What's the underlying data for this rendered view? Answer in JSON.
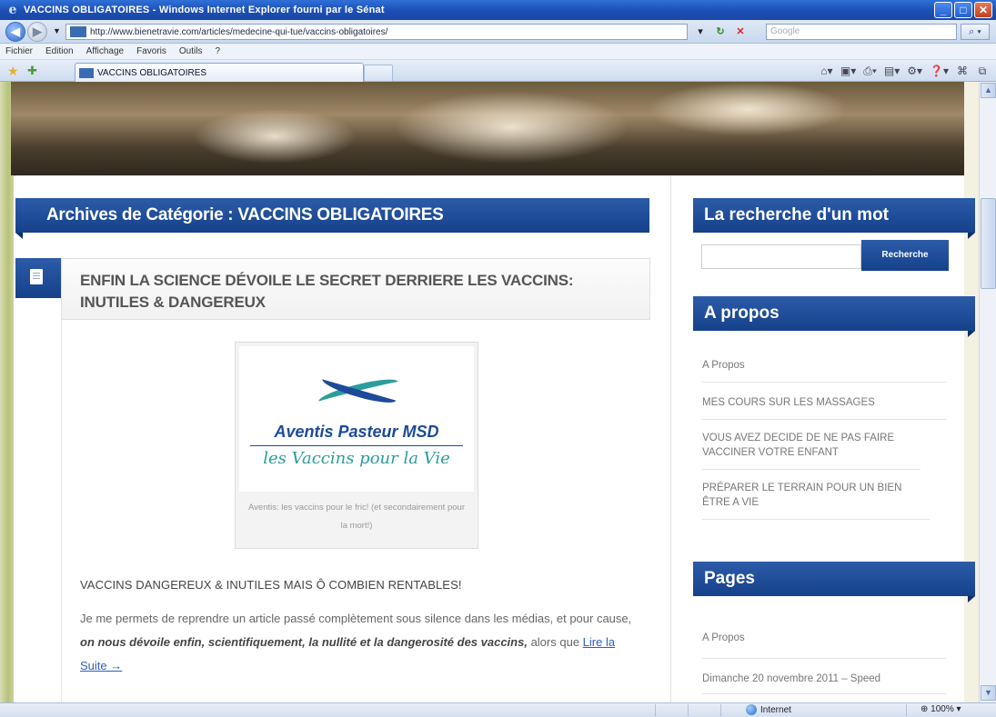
{
  "window": {
    "title": "VACCINS OBLIGATOIRES - Windows Internet Explorer fourni par le Sénat"
  },
  "address": {
    "url": "http://www.bienetravie.com/articles/medecine-qui-tue/vaccins-obligatoires/",
    "search_placeholder": "Google"
  },
  "menu": [
    "Fichier",
    "Edition",
    "Affichage",
    "Favoris",
    "Outils",
    "?"
  ],
  "tab": {
    "label": "VACCINS OBLIGATOIRES"
  },
  "page": {
    "archive_title": "Archives de Catégorie : VACCINS OBLIGATOIRES",
    "post_title": "ENFIN LA SCIENCE DÉVOILE LE SECRET DERRIERE LES VACCINS: INUTILES & DANGEREUX",
    "figure": {
      "logo_line1": "Aventis Pasteur MSD",
      "logo_line2": "les Vaccins pour la Vie",
      "caption": "Aventis: les vaccins pour le fric! (et secondairement pour la mort!)"
    },
    "subheading": "VACCINS DANGEREUX & INUTILES MAIS Ô COMBIEN RENTABLES!",
    "excerpt_start": "Je me permets de reprendre un article passé complètement sous silence dans les médias, et pour cause, ",
    "excerpt_bold": "on nous dévoile enfin, scientifiquement, la nullité et la dangerosité des vaccins,",
    "excerpt_end": " alors que ",
    "read_more": "Lire la Suite →"
  },
  "sidebar": {
    "search_heading": "La recherche d'un mot",
    "search_button": "Recherche",
    "apropos_heading": "A propos",
    "apropos_items": [
      "A Propos",
      "MES COURS SUR LES MASSAGES",
      "VOUS AVEZ DECIDE DE NE PAS FAIRE VACCINER VOTRE ENFANT",
      "PRÉPARER LE TERRAIN POUR UN BIEN ÊTRE A VIE"
    ],
    "pages_heading": "Pages",
    "pages_items": [
      "A Propos",
      "Dimanche 20 novembre 2011 – Speed"
    ]
  },
  "status": {
    "zone": "Internet",
    "zoom": "100%"
  }
}
